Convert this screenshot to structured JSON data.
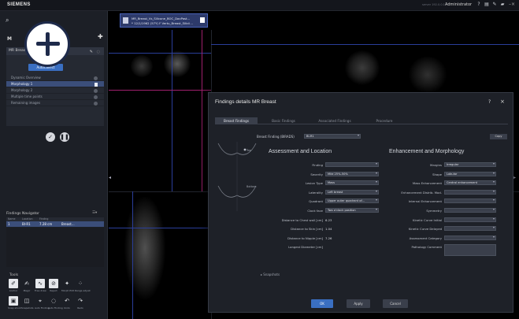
{
  "topbar": {
    "brand": "SIEMENS",
    "user_sub": "server 192.0.0.1",
    "user": "Administrator",
    "icons": [
      "help-icon",
      "monitor-icon",
      "pen-icon",
      "paint-icon"
    ],
    "close": "–×"
  },
  "sidebar": {
    "heading": "M",
    "workflow": {
      "header": "MR Breast",
      "autocollect": "AutoCollect",
      "items": [
        {
          "label": "Dynamic Overview",
          "selected": false
        },
        {
          "label": "Morphology 1",
          "selected": true
        },
        {
          "label": "Morphology 2",
          "selected": false
        },
        {
          "label": "Multiple time points",
          "selected": false
        },
        {
          "label": "Remaining images",
          "selected": false
        }
      ]
    },
    "navigator": {
      "title": "Findings Navigator",
      "tools_label": "☰▾",
      "columns": [
        "Name",
        "Location",
        "Finding",
        "",
        ""
      ],
      "row": [
        "1",
        "BI-R1",
        "7.28 cm",
        "Breast...",
        ""
      ]
    },
    "tools": {
      "label": "Tools",
      "row1": [
        {
          "icon": "brush-icon",
          "label": "Anchor"
        },
        {
          "icon": "stamp-icon",
          "label": "Magic"
        },
        {
          "icon": "line-icon",
          "label": "Free draw"
        },
        {
          "icon": "reject-icon",
          "label": "Reject"
        },
        {
          "icon": "morph-icon",
          "label": "Morph Edit"
        },
        {
          "icon": "dots-icon",
          "label": "Range adjust"
        }
      ],
      "row2": [
        {
          "icon": "box-icon",
          "label": "Snap shoot"
        },
        {
          "icon": "layers-icon",
          "label": "Snapshots"
        },
        {
          "icon": "cross-icon",
          "label": "Auto Finding"
        },
        {
          "icon": "lasso-icon",
          "label": "Auto Finding"
        },
        {
          "icon": "undo-icon",
          "label": "Undo"
        },
        {
          "icon": "redo-icon",
          "label": "Redo"
        }
      ]
    }
  },
  "viewer": {
    "study_tab": {
      "line1": "MR_Breast_Vs_Silicone_BOC_DaxPast...",
      "line2": "* 12/1/1962 (57Y) F Vertu_Breast_Silicii..."
    }
  },
  "dialog": {
    "title": "Findings details MR Breast",
    "help": "?",
    "close": "×",
    "tabs": [
      "Breast Findings",
      "Basic Findings",
      "Associated Findings",
      "Procedure"
    ],
    "breast_finding_label": "Breast Finding (BIRADS)",
    "breast_finding_value": "BI-R1",
    "copy": "Copy",
    "sketch_labels": {
      "upper": "Top",
      "lower": "Bottom"
    },
    "left_section": {
      "title": "Assessment and Location",
      "fields": [
        {
          "label": "Finding",
          "value": "",
          "type": "combo"
        },
        {
          "label": "Severity",
          "value": "Mild 25%-50%",
          "type": "combo"
        },
        {
          "label": "Lesion Type",
          "value": "Mass",
          "type": "combo"
        },
        {
          "label": "Laterality",
          "value": "Left breast",
          "type": "combo"
        },
        {
          "label": "Quadrant",
          "value": "Upper outer quadrant of...",
          "type": "combo"
        },
        {
          "label": "Clock face",
          "value": "Two o'clock position",
          "type": "combo"
        },
        {
          "label": "Distance to Chest wall [cm]",
          "value": "6.23",
          "type": "text"
        },
        {
          "label": "Distance to Skin [cm]",
          "value": "1.04",
          "type": "text"
        },
        {
          "label": "Distance to Nipple [cm]",
          "value": "7.26",
          "type": "text"
        },
        {
          "label": "Longest Diameter [cm]",
          "value": "",
          "type": "text"
        }
      ]
    },
    "right_section": {
      "title": "Enhancement and Morphology",
      "fields": [
        {
          "label": "Margins",
          "value": "Irregular",
          "type": "combo"
        },
        {
          "label": "Shape",
          "value": "Lobular",
          "type": "combo"
        },
        {
          "label": "Mass Enhancement",
          "value": "Central enhancement",
          "type": "combo"
        },
        {
          "label": "Enhancement Distrib. Mod.",
          "value": "",
          "type": "combo"
        },
        {
          "label": "Internal Enhancement",
          "value": "",
          "type": "combo"
        },
        {
          "label": "Symmetry",
          "value": "",
          "type": "combo"
        },
        {
          "label": "Kinetic Curve Initial",
          "value": "",
          "type": "combo"
        },
        {
          "label": "Kinetic Curve Delayed",
          "value": "",
          "type": "combo"
        },
        {
          "label": "Assessment Category",
          "value": "",
          "type": "combo"
        },
        {
          "label": "Pathology Comment",
          "value": "",
          "type": "textarea"
        }
      ]
    },
    "snapshots": "Snapshots",
    "buttons": {
      "ok": "OK",
      "apply": "Apply",
      "cancel": "Cancel"
    }
  },
  "colors": {
    "accent": "#3a6fc2",
    "selection": "#3b4e7a",
    "crosshair": "#2a3e9a",
    "marker": "#a0206e"
  }
}
